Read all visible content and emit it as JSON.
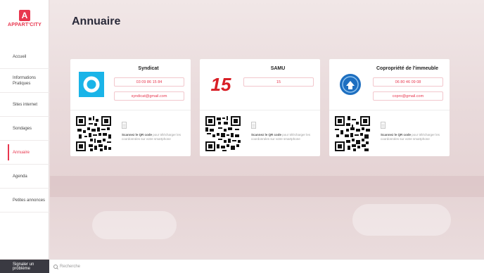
{
  "app": {
    "brand_mark": "A",
    "brand_text": "APPART'CITY"
  },
  "sidebar": {
    "items": [
      {
        "label": "Accueil",
        "active": false
      },
      {
        "label": "Informations Pratiques",
        "active": false
      },
      {
        "label": "Sites internet",
        "active": false
      },
      {
        "label": "Sondages",
        "active": false
      },
      {
        "label": "Annuaire",
        "active": true
      },
      {
        "label": "Agenda",
        "active": false
      },
      {
        "label": "Petites annonces",
        "active": false
      }
    ]
  },
  "page": {
    "title": "Annuaire"
  },
  "contacts": [
    {
      "name": "Syndicat",
      "logo": "syndicat-logo",
      "phone": "03 09 86 15 84",
      "email": "syndicat@gmail.com",
      "scan_bold": "Scannez le QR code",
      "scan_rest": "pour télécharger les coordonnées sur votre smartphone"
    },
    {
      "name": "SAMU",
      "logo": "samu-logo",
      "phone": "15",
      "email": "",
      "scan_bold": "Scannez le QR code",
      "scan_rest": "pour télécharger les coordonnées sur votre smartphone"
    },
    {
      "name": "Copropriété de l'immeuble",
      "logo": "copropriete-logo",
      "phone": "06 80 46 09 08",
      "email": "copro@gmail.com",
      "scan_bold": "Scannez le QR code",
      "scan_rest": "pour télécharger les coordonnées sur votre smartphone"
    }
  ],
  "bottombar": {
    "report_label": "Signaler un problème",
    "search_placeholder": "Recherche"
  },
  "logos": {
    "samu_text": "15"
  },
  "colors": {
    "accent": "#e8364e",
    "syndicat_logo": "#1ab4e8",
    "samu_logo": "#d81f26",
    "copro_logo": "#1e6fc0",
    "sidebar_bottom": "#3a3a42"
  }
}
